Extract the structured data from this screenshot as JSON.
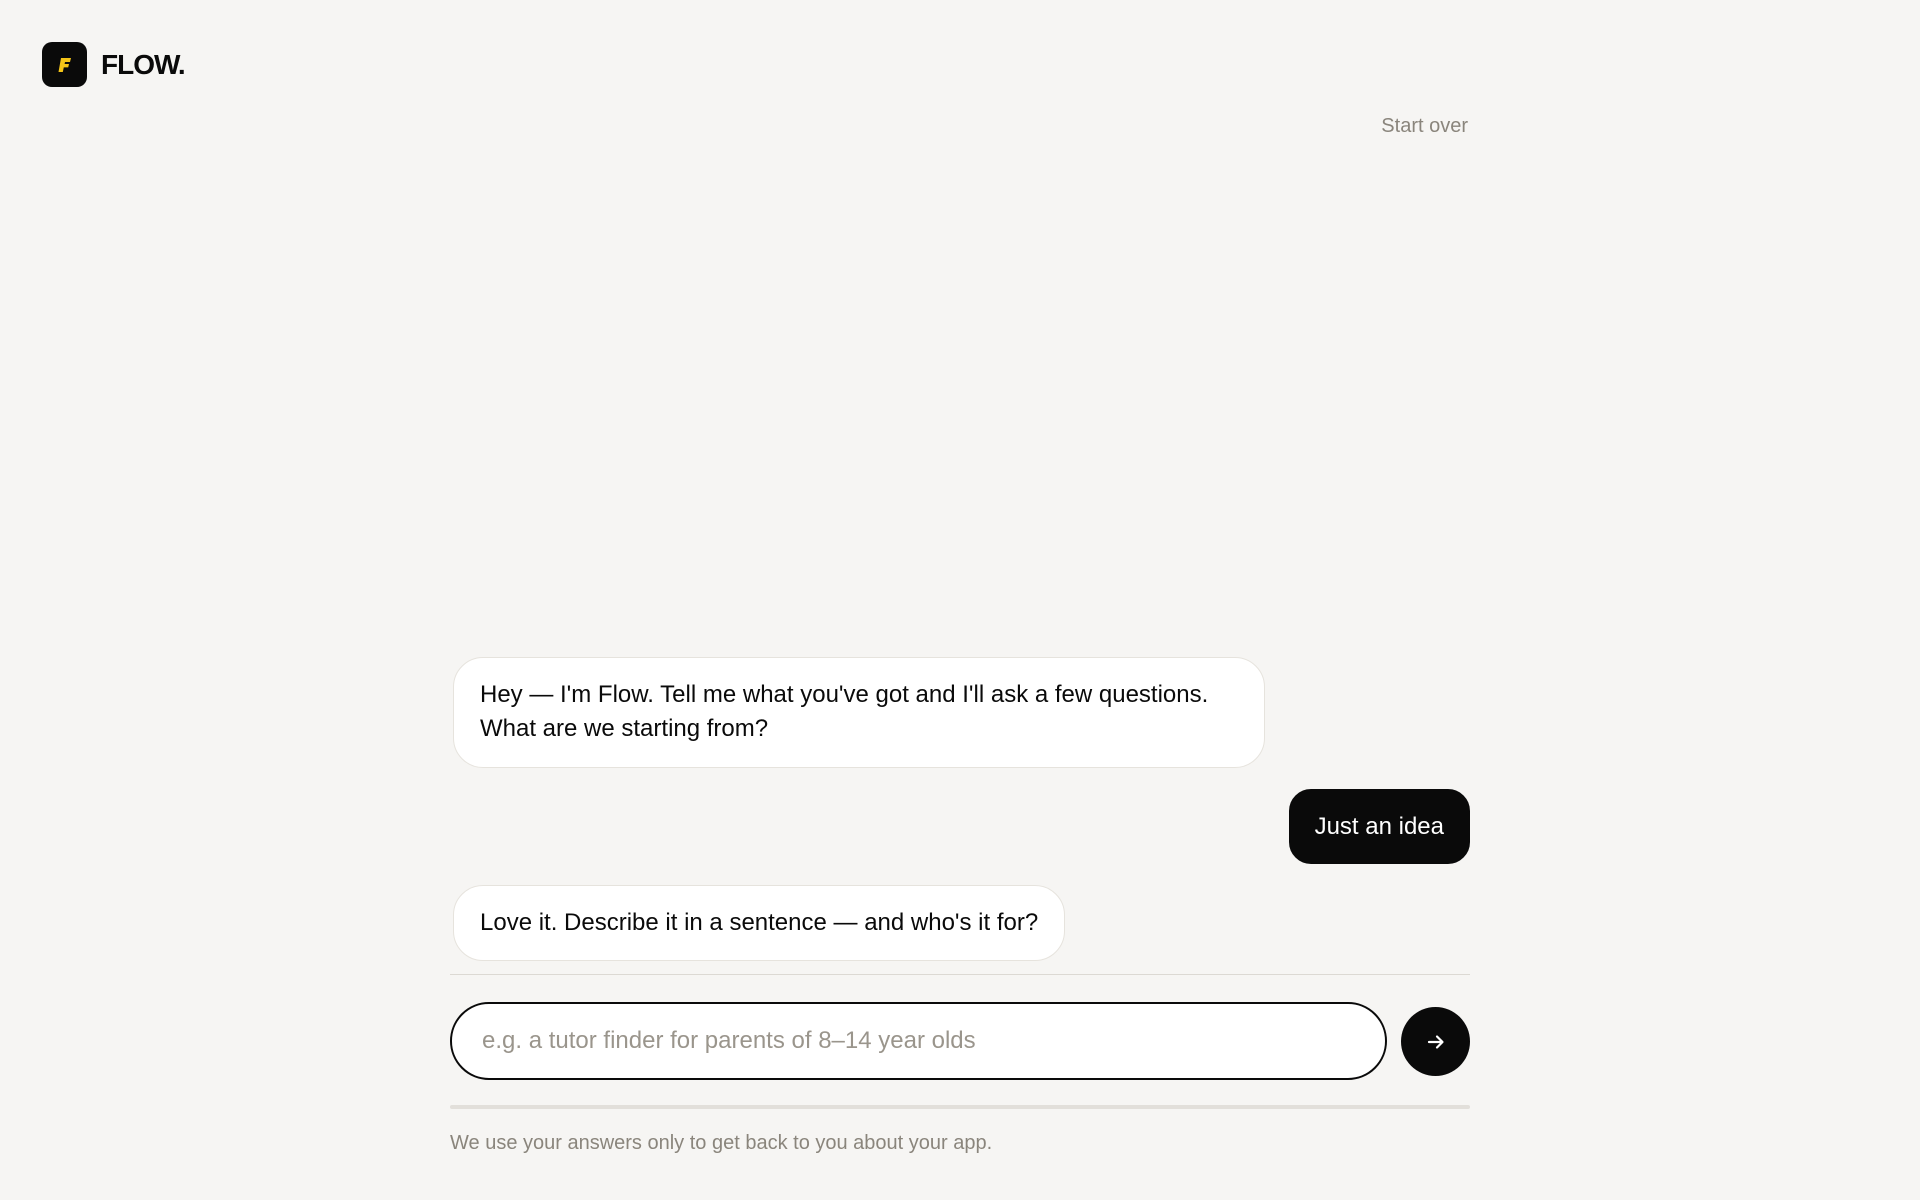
{
  "brand": {
    "logo_letter": "F",
    "name": "FLOW.",
    "accent_color": "#f5c518"
  },
  "header": {
    "start_over_label": "Start over"
  },
  "messages": [
    {
      "role": "bot",
      "text": "Hey — I'm Flow. Tell me what you've got and I'll ask a few questions. What are we starting from?"
    },
    {
      "role": "user",
      "text": "Just an idea"
    },
    {
      "role": "bot",
      "text": "Love it. Describe it in a sentence — and who's it for?"
    }
  ],
  "composer": {
    "placeholder": "e.g. a tutor finder for parents of 8–14 year olds",
    "value": "",
    "send_icon": "arrow-right-icon"
  },
  "footer": {
    "note": "We use your answers only to get back to you about your app."
  }
}
